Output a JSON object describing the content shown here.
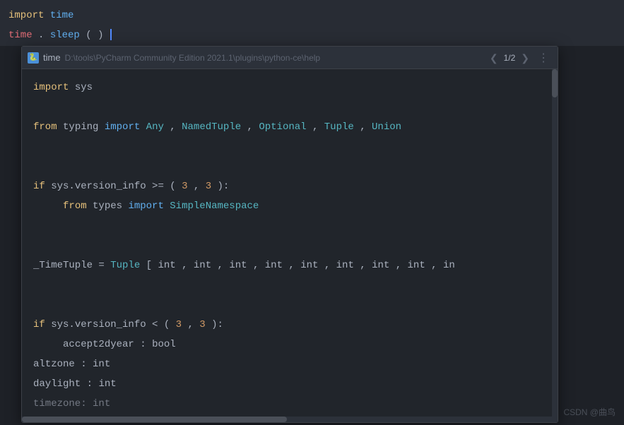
{
  "editor": {
    "top_line1": {
      "keyword": "import",
      "module": "time"
    },
    "top_line2": {
      "code": "time.sleep()"
    }
  },
  "popup": {
    "header": {
      "icon_label": "🐍",
      "title": "time",
      "path": "D:\\tools\\PyCharm Community Edition 2021.1\\plugins\\python-ce\\help",
      "nav_prev": "❮",
      "nav_next": "❯",
      "nav_count": "1/2",
      "more": "⋮"
    },
    "code_lines": [
      {
        "id": 1,
        "type": "code",
        "content": "import sys"
      },
      {
        "id": 2,
        "type": "empty"
      },
      {
        "id": 3,
        "type": "code",
        "content": "from typing import Any, NamedTuple, Optional, Tuple, Union"
      },
      {
        "id": 4,
        "type": "empty"
      },
      {
        "id": 5,
        "type": "empty"
      },
      {
        "id": 6,
        "type": "code",
        "content": "if sys.version_info >= (3, 3):"
      },
      {
        "id": 7,
        "type": "code",
        "content": "    from types import SimpleNamespace"
      },
      {
        "id": 8,
        "type": "empty"
      },
      {
        "id": 9,
        "type": "empty"
      },
      {
        "id": 10,
        "type": "code",
        "content": "_TimeTuple = Tuple[int, int, int, int, int, int, int, int, in"
      },
      {
        "id": 11,
        "type": "empty"
      },
      {
        "id": 12,
        "type": "empty"
      },
      {
        "id": 13,
        "type": "code",
        "content": "if sys.version_info < (3, 3):"
      },
      {
        "id": 14,
        "type": "code",
        "content": "    accept2dyear: bool"
      },
      {
        "id": 15,
        "type": "code",
        "content": "altzone: int"
      },
      {
        "id": 16,
        "type": "code",
        "content": "daylight: int"
      },
      {
        "id": 17,
        "type": "code",
        "content": "timezone: int"
      }
    ]
  },
  "watermark": "CSDN @曲鸟"
}
